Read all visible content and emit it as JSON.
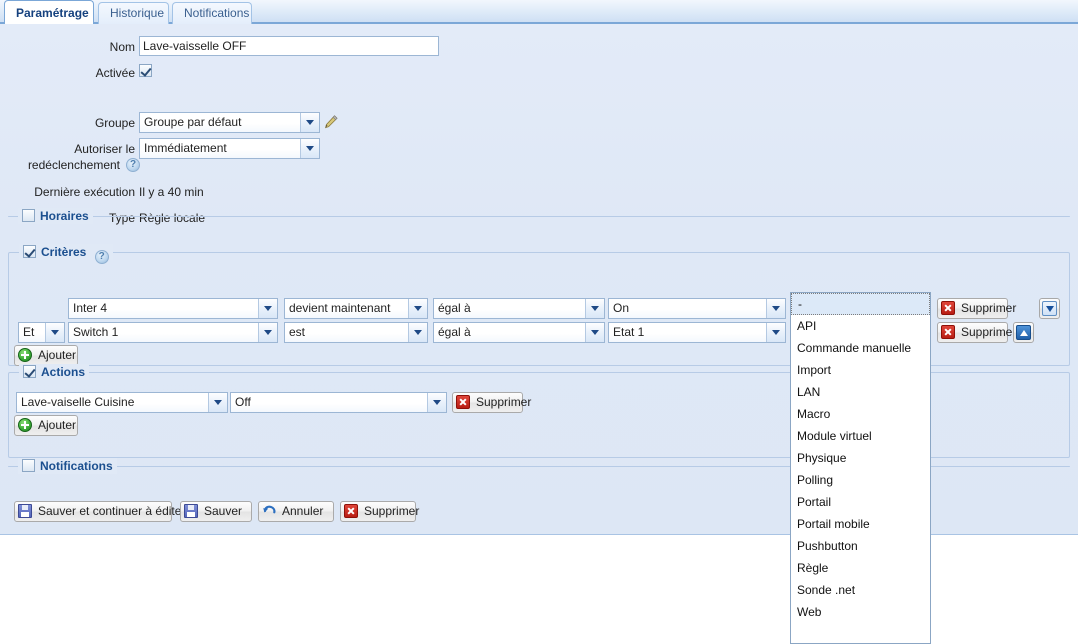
{
  "tabs": [
    {
      "label": "Paramétrage",
      "active": true
    },
    {
      "label": "Historique",
      "active": false
    },
    {
      "label": "Notifications",
      "active": false
    }
  ],
  "form": {
    "nom_label": "Nom",
    "nom_value": "Lave-vaisselle OFF",
    "activee_label": "Activée",
    "activee_checked": true,
    "groupe_label": "Groupe",
    "groupe_value": "Groupe par défaut",
    "redeclenchement_label_line1": "Autoriser le",
    "redeclenchement_label_line2": "redéclenchement",
    "redeclenchement_value": "Immédiatement",
    "derniere_execution_label": "Dernière exécution",
    "derniere_execution_value": "Il y a 40 min",
    "type_label": "Type",
    "type_value": "Règle locale",
    "help_glyph": "?"
  },
  "sections": {
    "horaires": {
      "legend": "Horaires",
      "checked": false
    },
    "criteres": {
      "legend": "Critères",
      "checked": true
    },
    "actions": {
      "legend": "Actions",
      "checked": true
    },
    "notifications": {
      "legend": "Notifications",
      "checked": false
    }
  },
  "criteria": {
    "rows": [
      {
        "conjunction": "",
        "source": "Inter 4",
        "event": "devient maintenant",
        "operator": "égal à",
        "value": "On",
        "origin": "",
        "delete_label": "Supprimer",
        "move": "down"
      },
      {
        "conjunction": "Et",
        "source": "Switch 1",
        "event": "est",
        "operator": "égal à",
        "value": "Etat 1",
        "origin": "",
        "delete_label": "Supprimer",
        "move": "up"
      }
    ],
    "add_label": "Ajouter"
  },
  "origin_dropdown": {
    "open": true,
    "selected_index": 0,
    "options": [
      "-",
      "API",
      "Commande manuelle",
      "Import",
      "LAN",
      "Macro",
      "Module virtuel",
      "Physique",
      "Polling",
      "Portail",
      "Portail mobile",
      "Pushbutton",
      "Règle",
      "Sonde .net",
      "Web"
    ]
  },
  "actions": {
    "rows": [
      {
        "target": "Lave-vaiselle Cuisine",
        "state": "Off",
        "delete_label": "Supprimer"
      }
    ],
    "add_label": "Ajouter"
  },
  "footer": {
    "save_continue_label": "Sauver et continuer à éditer",
    "save_label": "Sauver",
    "cancel_label": "Annuler",
    "delete_label": "Supprimer"
  },
  "colors": {
    "panel_bg": "#dfe8f6",
    "legend_text": "#1b4f8f",
    "tab_active_text": "#15417e",
    "accent_blue": "#3f8ee0",
    "delete_red": "#b81d13",
    "add_green": "#3fae38"
  }
}
